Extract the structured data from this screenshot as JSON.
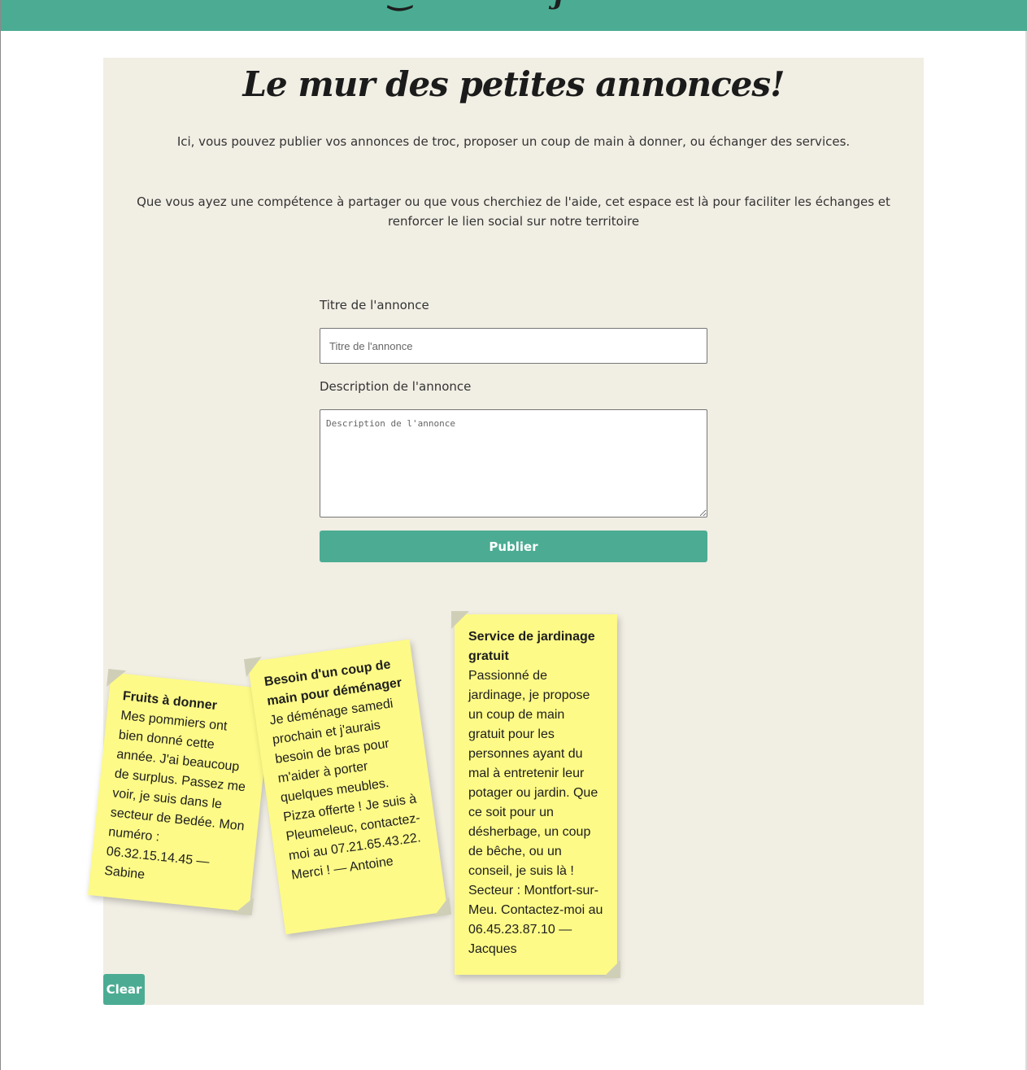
{
  "page": {
    "title": "Le mur des petites annonces!",
    "intro": "Ici, vous pouvez publier vos annonces de troc, proposer un coup de main à donner, ou échanger des services.",
    "intro2": "Que vous ayez une compétence à partager ou que vous cherchiez de l'aide, cet espace est là pour faciliter les échanges et renforcer le lien social sur notre territoire"
  },
  "form": {
    "title_label": "Titre de l'annonce",
    "title_placeholder": "Titre de l'annonce",
    "title_value": "",
    "desc_label": "Description de l'annonce",
    "desc_placeholder": "Description de l'annonce",
    "desc_value": "",
    "publish_label": "Publier"
  },
  "clear_label": "Clear",
  "notes": [
    {
      "title": "Fruits à donner",
      "body": "Mes pommiers ont bien donné cette année. J'ai beaucoup de surplus. Passez me voir, je suis dans le secteur de Bedée. Mon numéro : 06.32.15.14.45 — Sabine"
    },
    {
      "title": "Besoin d'un coup de main pour déménager",
      "body": "Je déménage samedi prochain et j'aurais besoin de bras pour m'aider à porter quelques meubles. Pizza offerte ! Je suis à Pleumeleuc, contactez-moi au 07.21.65.43.22. Merci ! — Antoine"
    },
    {
      "title": "Service de jardinage gratuit",
      "body": "Passionné de jardinage, je propose un coup de main gratuit pour les personnes ayant du mal à entretenir leur potager ou jardin. Que ce soit pour un désherbage, un coup de bêche, ou un conseil, je suis là ! Secteur : Montfort-sur-Meu. Contactez-moi au 06.45.23.87.10 — Jacques"
    }
  ],
  "colors": {
    "accent": "#4bac93",
    "panel": "#f1eee4",
    "note": "#fdfa87"
  }
}
